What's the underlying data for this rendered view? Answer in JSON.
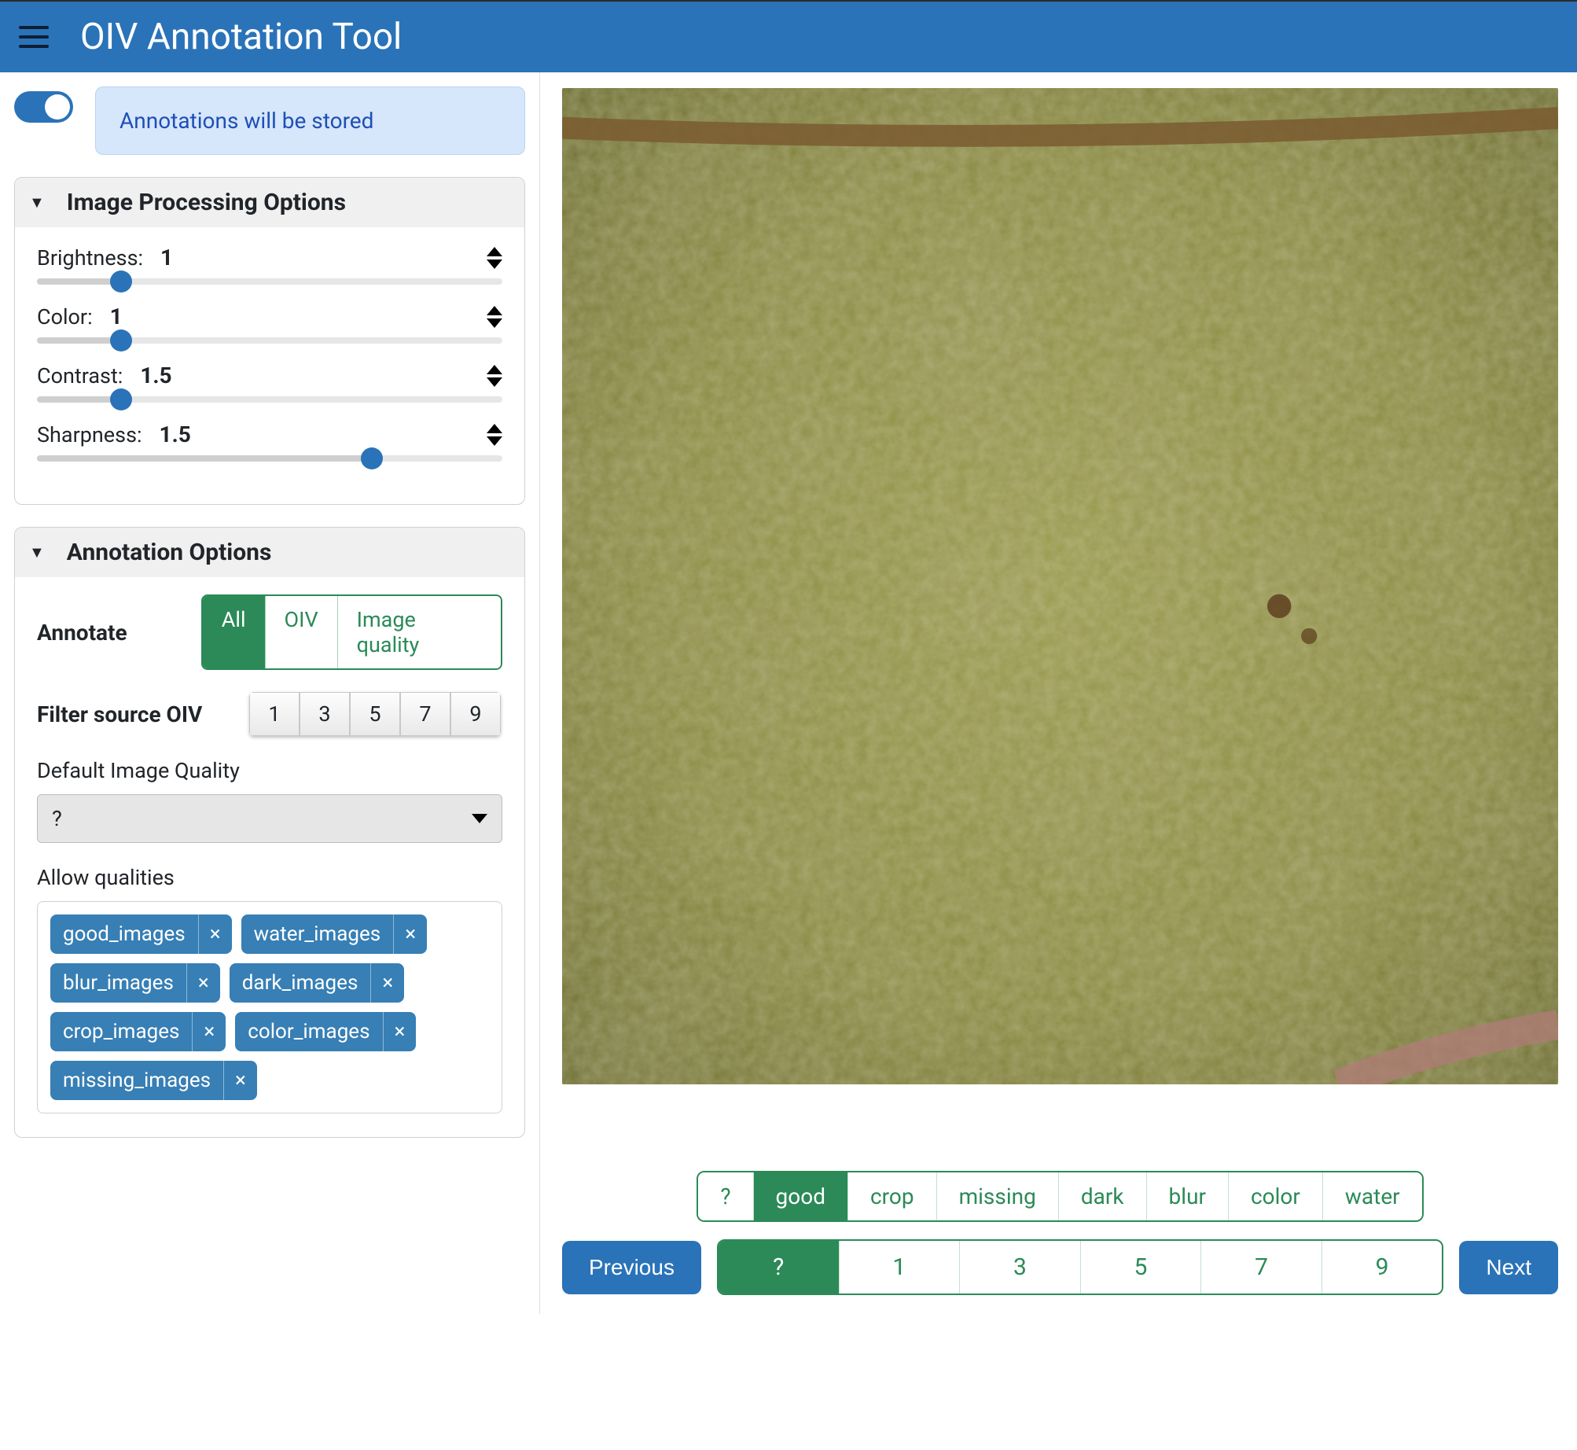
{
  "header": {
    "title": "OIV Annotation Tool"
  },
  "notice": "Annotations will be stored",
  "panels": {
    "image_proc": {
      "title": "Image Processing Options",
      "sliders": {
        "brightness": {
          "label": "Brightness:",
          "value": "1",
          "pct": 18
        },
        "color": {
          "label": "Color:",
          "value": "1",
          "pct": 18
        },
        "contrast": {
          "label": "Contrast:",
          "value": "1.5",
          "pct": 18
        },
        "sharpness": {
          "label": "Sharpness:",
          "value": "1.5",
          "pct": 72
        }
      }
    },
    "annotation": {
      "title": "Annotation Options",
      "annotate_label": "Annotate",
      "annotate_options": [
        "All",
        "OIV",
        "Image quality"
      ],
      "annotate_active": 0,
      "filter_label": "Filter source OIV",
      "filter_options": [
        "1",
        "3",
        "5",
        "7",
        "9"
      ],
      "default_quality_label": "Default Image Quality",
      "default_quality_value": "?",
      "allow_label": "Allow qualities",
      "allow_tags": [
        "good_images",
        "water_images",
        "blur_images",
        "dark_images",
        "crop_images",
        "color_images",
        "missing_images"
      ]
    }
  },
  "main": {
    "quality_buttons": [
      "?",
      "good",
      "crop",
      "missing",
      "dark",
      "blur",
      "color",
      "water"
    ],
    "quality_active": 1,
    "oiv_buttons": [
      "?",
      "1",
      "3",
      "5",
      "7",
      "9"
    ],
    "oiv_active": 0,
    "prev": "Previous",
    "next": "Next"
  }
}
